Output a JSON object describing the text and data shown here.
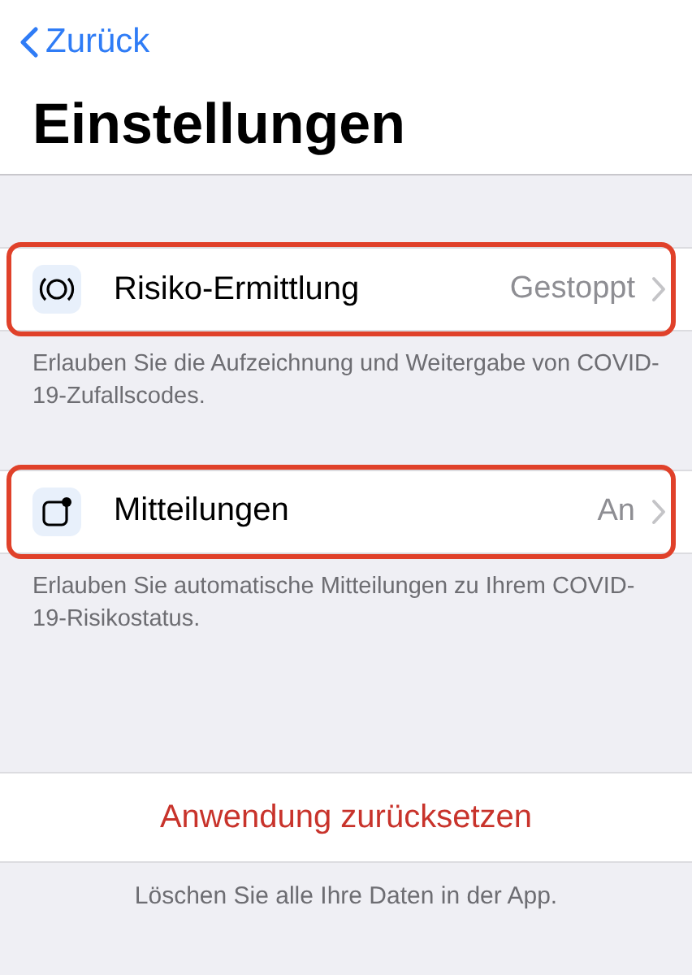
{
  "nav": {
    "back_label": "Zurück"
  },
  "title": "Einstellungen",
  "sections": [
    {
      "row": {
        "kind": "exposure",
        "label": "Risiko-Ermittlung",
        "value": "Gestoppt",
        "highlighted": true
      },
      "footer": "Erlauben Sie die Aufzeichnung und Weitergabe von COVID-19-Zufallscodes."
    },
    {
      "row": {
        "kind": "notifications",
        "label": "Mitteilungen",
        "value": "An",
        "highlighted": true
      },
      "footer": "Erlauben Sie automatische Mitteilungen zu Ihrem COVID-19-Risikostatus."
    }
  ],
  "reset": {
    "label": "Anwendung zurücksetzen",
    "footer": "Löschen Sie alle Ihre Daten in der App."
  }
}
